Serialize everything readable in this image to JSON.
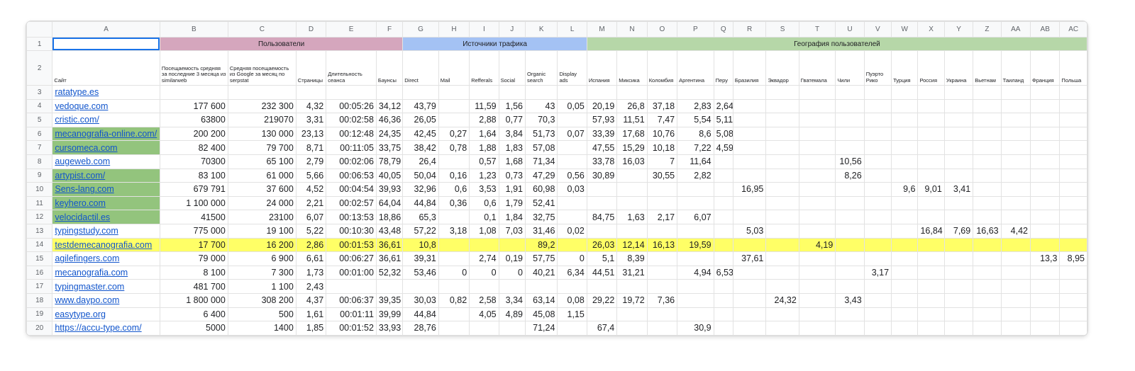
{
  "columns": [
    "A",
    "B",
    "C",
    "D",
    "E",
    "F",
    "G",
    "H",
    "I",
    "J",
    "K",
    "L",
    "M",
    "N",
    "O",
    "P",
    "Q",
    "R",
    "S",
    "T",
    "U",
    "V",
    "W",
    "X",
    "Y",
    "Z",
    "AA",
    "AB",
    "AC"
  ],
  "groups": {
    "users": "Пользователи",
    "traffic": "Источники трафика",
    "geo": "География пользователей"
  },
  "subheaders": [
    "Сайт",
    "Посещаемость средняя за последние 3 месяца из similarweb",
    "Средняя посещаемость из Google за месяц по serpstat",
    "Страницы",
    "Длительность сеанса",
    "Баунсы",
    "Direct",
    "Mail",
    "Refferals",
    "Social",
    "Organic search",
    "Display ads",
    "Испания",
    "Миксика",
    "Коломбия",
    "Аргентина",
    "Перу",
    "Бразилия",
    "Эквадор",
    "Гватемала",
    "Чили",
    "Пуэрто Рико",
    "Турция",
    "Россия",
    "Украина",
    "Вьетнам",
    "Таиланд",
    "Франция",
    "Польша"
  ],
  "rows": [
    [
      "ratatype.es",
      "",
      "",
      "",
      "",
      "",
      "",
      "",
      "",
      "",
      "",
      "",
      "",
      "",
      "",
      "",
      "",
      "",
      "",
      "",
      "",
      "",
      "",
      "",
      "",
      "",
      "",
      "",
      ""
    ],
    [
      "vedoque.com",
      "177 600",
      "232 300",
      "4,32",
      "00:05:26",
      "34,12",
      "43,79",
      "",
      "11,59",
      "1,56",
      "43",
      "0,05",
      "20,19",
      "26,8",
      "37,18",
      "2,83",
      "2,64",
      "",
      "",
      "",
      "",
      "",
      "",
      "",
      "",
      "",
      "",
      "",
      ""
    ],
    [
      "cristic.com/",
      "63800",
      "219070",
      "3,31",
      "00:02:58",
      "46,36",
      "26,05",
      "",
      "2,88",
      "0,77",
      "70,3",
      "",
      "57,93",
      "11,51",
      "7,47",
      "5,54",
      "5,11",
      "",
      "",
      "",
      "",
      "",
      "",
      "",
      "",
      "",
      "",
      "",
      ""
    ],
    [
      "mecanografia-online.com/",
      "200 200",
      "130 000",
      "23,13",
      "00:12:48",
      "24,35",
      "42,45",
      "0,27",
      "1,64",
      "3,84",
      "51,73",
      "0,07",
      "33,39",
      "17,68",
      "10,76",
      "8,6",
      "5,08",
      "",
      "",
      "",
      "",
      "",
      "",
      "",
      "",
      "",
      "",
      "",
      ""
    ],
    [
      "cursomeca.com",
      "82 400",
      "79 700",
      "8,71",
      "00:11:05",
      "33,75",
      "38,42",
      "0,78",
      "1,88",
      "1,83",
      "57,08",
      "",
      "47,55",
      "15,29",
      "10,18",
      "7,22",
      "4,59",
      "",
      "",
      "",
      "",
      "",
      "",
      "",
      "",
      "",
      "",
      "",
      ""
    ],
    [
      "augeweb.com",
      "70300",
      "65 100",
      "2,79",
      "00:02:06",
      "78,79",
      "26,4",
      "",
      "0,57",
      "1,68",
      "71,34",
      "",
      "33,78",
      "16,03",
      "7",
      "11,64",
      "",
      "",
      "",
      "",
      "10,56",
      "",
      "",
      "",
      "",
      "",
      "",
      "",
      ""
    ],
    [
      "artypist.com/",
      "83 100",
      "61 000",
      "5,66",
      "00:06:53",
      "40,05",
      "50,04",
      "0,16",
      "1,23",
      "0,73",
      "47,29",
      "0,56",
      "30,89",
      "",
      "30,55",
      "2,82",
      "",
      "",
      "",
      "",
      "8,26",
      "",
      "",
      "",
      "",
      "",
      "",
      "",
      ""
    ],
    [
      "Sens-lang.com",
      "679 791",
      "37 600",
      "4,52",
      "00:04:54",
      "39,93",
      "32,96",
      "0,6",
      "3,53",
      "1,91",
      "60,98",
      "0,03",
      "",
      "",
      "",
      "",
      "",
      "16,95",
      "",
      "",
      "",
      "",
      "9,6",
      "9,01",
      "3,41",
      "",
      "",
      "",
      ""
    ],
    [
      "keyhero.com",
      "1 100 000",
      "24 000",
      "2,21",
      "00:02:57",
      "64,04",
      "44,84",
      "0,36",
      "0,6",
      "1,79",
      "52,41",
      "",
      "",
      "",
      "",
      "",
      "",
      "",
      "",
      "",
      "",
      "",
      "",
      "",
      "",
      "",
      "",
      "",
      ""
    ],
    [
      "velocidactil.es",
      "41500",
      "23100",
      "6,07",
      "00:13:53",
      "18,86",
      "65,3",
      "",
      "0,1",
      "1,84",
      "32,75",
      "",
      "84,75",
      "1,63",
      "2,17",
      "6,07",
      "",
      "",
      "",
      "",
      "",
      "",
      "",
      "",
      "",
      "",
      "",
      "",
      ""
    ],
    [
      "typingstudy.com",
      "775 000",
      "19 100",
      "5,22",
      "00:10:30",
      "43,48",
      "57,22",
      "3,18",
      "1,08",
      "7,03",
      "31,46",
      "0,02",
      "",
      "",
      "",
      "",
      "",
      "5,03",
      "",
      "",
      "",
      "",
      "",
      "16,84",
      "7,69",
      "16,63",
      "4,42",
      "",
      ""
    ],
    [
      "testdemecanografia.com",
      "17 700",
      "16 200",
      "2,86",
      "00:01:53",
      "36,61",
      "10,8",
      "",
      "",
      "",
      "89,2",
      "",
      "26,03",
      "12,14",
      "16,13",
      "19,59",
      "",
      "",
      "",
      "4,19",
      "",
      "",
      "",
      "",
      "",
      "",
      "",
      "",
      ""
    ],
    [
      "agilefingers.com",
      "79 000",
      "6 900",
      "6,61",
      "00:06:27",
      "36,61",
      "39,31",
      "",
      "2,74",
      "0,19",
      "57,75",
      "0",
      "5,1",
      "8,39",
      "",
      "",
      "",
      "37,61",
      "",
      "",
      "",
      "",
      "",
      "",
      "",
      "",
      "",
      "13,3",
      "8,95"
    ],
    [
      "mecanografia.com",
      "8 100",
      "7 300",
      "1,73",
      "00:01:00",
      "52,32",
      "53,46",
      "0",
      "0",
      "0",
      "40,21",
      "6,34",
      "44,51",
      "31,21",
      "",
      "4,94",
      "6,53",
      "",
      "",
      "",
      "",
      "3,17",
      "",
      "",
      "",
      "",
      "",
      "",
      ""
    ],
    [
      "typingmaster.com",
      "481 700",
      "1 100",
      "2,43",
      "",
      "",
      "",
      "",
      "",
      "",
      "",
      "",
      "",
      "",
      "",
      "",
      "",
      "",
      "",
      "",
      "",
      "",
      "",
      "",
      "",
      "",
      "",
      "",
      ""
    ],
    [
      "www.daypo.com",
      "1 800 000",
      "308 200",
      "4,37",
      "00:06:37",
      "39,35",
      "30,03",
      "0,82",
      "2,58",
      "3,34",
      "63,14",
      "0,08",
      "29,22",
      "19,72",
      "7,36",
      "",
      "",
      "",
      "24,32",
      "",
      "3,43",
      "",
      "",
      "",
      "",
      "",
      "",
      "",
      ""
    ],
    [
      "easytype.org",
      "6 400",
      "500",
      "1,61",
      "00:01:11",
      "39,99",
      "44,84",
      "",
      "4,05",
      "4,89",
      "45,08",
      "1,15",
      "",
      "",
      "",
      "",
      "",
      "",
      "",
      "",
      "",
      "",
      "",
      "",
      "",
      "",
      "",
      "",
      ""
    ],
    [
      "https://accu-type.com/",
      "5000",
      "1400",
      "1,85",
      "00:01:52",
      "33,93",
      "28,76",
      "",
      "",
      "",
      "71,24",
      "",
      "67,4",
      "",
      "",
      "30,9",
      "",
      "",
      "",
      "",
      "",
      "",
      "",
      "",
      "",
      "",
      "",
      "",
      ""
    ]
  ],
  "row_numbers": [
    "1",
    "2",
    "3",
    "4",
    "5",
    "6",
    "7",
    "8",
    "9",
    "10",
    "11",
    "12",
    "13",
    "14",
    "15",
    "16",
    "17",
    "18",
    "19",
    "20"
  ],
  "highlights": {
    "green_rows": [
      3,
      4,
      6,
      7,
      8,
      9
    ],
    "yellow_row": 11,
    "green_color": "#93c47d",
    "yellow_color": "#ffff66",
    "users_color": "#d5a6bd",
    "traffic_color": "#a4c2f4",
    "geo_color": "#b6d7a8",
    "link_color": "#1155cc",
    "selection_color": "#1a73e8"
  }
}
